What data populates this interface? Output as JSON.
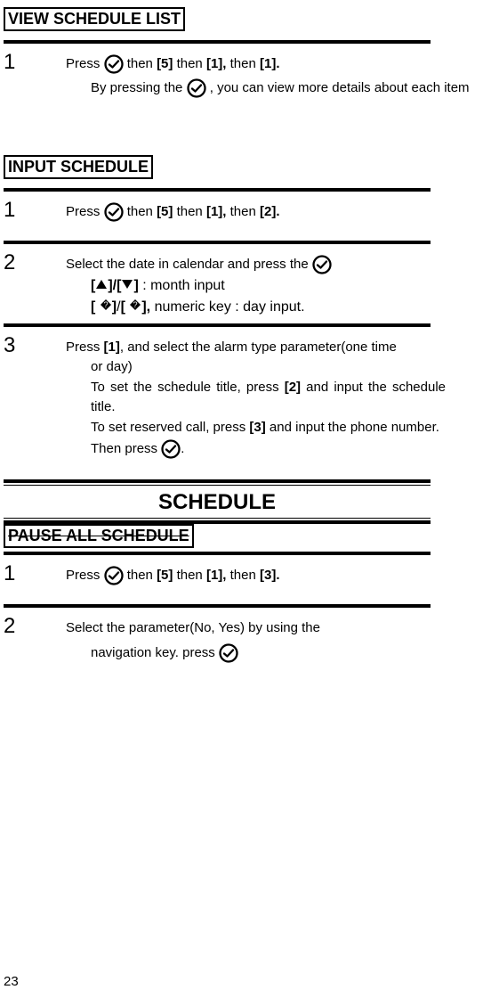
{
  "headers": {
    "view_schedule_list": "VIEW SCHEDULE LIST",
    "input_schedule": "INPUT SCHEDULE",
    "schedule_banner": "SCHEDULE",
    "pause_all_schedule": "PAUSE ALL SCHEDULE"
  },
  "view_schedule_list": {
    "step1_num": "1",
    "step1_a": "Press ",
    "step1_b": " then ",
    "step1_c": "[5]",
    "step1_d": " then ",
    "step1_e": "[1],",
    "step1_f": " then ",
    "step1_g": "[1].",
    "step1_sub_a": "By pressing the ",
    "step1_sub_b": ", you can view more details about each item"
  },
  "input_schedule": {
    "step1_num": "1",
    "step1_a": "Press ",
    "step1_b": " then ",
    "step1_c": "[5]",
    "step1_d": " then ",
    "step1_e": "[1],",
    "step1_f": " then ",
    "step1_g": "[2].",
    "step2_num": "2",
    "step2_a": "Select the date in calendar and press the ",
    "step2_sub1_a": "[",
    "step2_sub1_b": "]/[",
    "step2_sub1_c": "]",
    "step2_sub1_d": " : month input",
    "step2_sub2_a": "[ ",
    "step2_sub2_b": "]",
    "step2_sub2_c": "/",
    "step2_sub2_d": "[ ",
    "step2_sub2_e": "],",
    "step2_sub2_f": " numeric key : day input.",
    "step3_num": "3",
    "step3_a": "Press ",
    "step3_b": "[1]",
    "step3_c": ", and select the alarm type parameter(one time",
    "step3_sub1": "or day)",
    "step3_sub2a": "To set the schedule title, press ",
    "step3_sub2b": "[2]",
    "step3_sub2c": " and input the schedule title.",
    "step3_sub3a": "To set reserved call, press ",
    "step3_sub3b": "[3]",
    "step3_sub3c": " and input the phone number.",
    "step3_sub4a": "Then press ",
    "step3_sub4b": "."
  },
  "pause_all_schedule": {
    "step1_num": "1",
    "step1_a": "Press ",
    "step1_b": " then ",
    "step1_c": "[5]",
    "step1_d": " then ",
    "step1_e": "[1],",
    "step1_f": " then ",
    "step1_g": "[3].",
    "step2_num": "2",
    "step2_a": "Select the parameter(No, Yes) by using the",
    "step2_sub_a": "navigation key. press"
  },
  "page_number": "23",
  "icons": {
    "ok": "ok-circle-icon",
    "up": "triangle-up-icon",
    "down": "triangle-down-icon",
    "diamond_left": "diamond-icon",
    "diamond_right": "diamond-icon"
  }
}
